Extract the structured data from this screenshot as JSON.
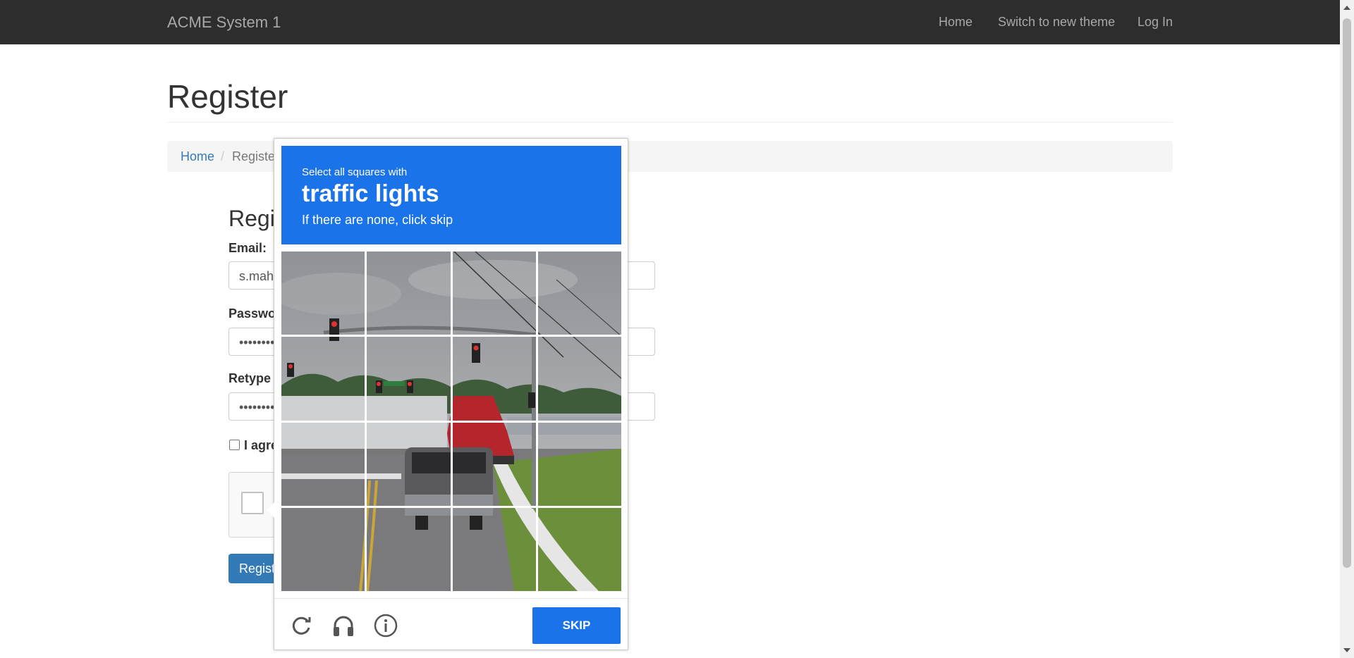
{
  "navbar": {
    "brand": "ACME System 1",
    "links": [
      "Home",
      "Switch to new theme",
      "Log In"
    ]
  },
  "page": {
    "title": "Register",
    "breadcrumb": {
      "home": "Home",
      "separator": "/",
      "current": "Registe"
    }
  },
  "form": {
    "heading": "Regi",
    "email_label": "Email:",
    "email_value": "s.mah",
    "password_label": "Passwo",
    "password_value": "•••••••••",
    "retype_label": "Retype",
    "retype_value": "•••••••••",
    "agree_label": "I agre",
    "register_label": "Regist"
  },
  "challenge": {
    "line1": "Select all squares with",
    "object": "traffic lights",
    "line3": "If there are none, click skip",
    "skip_label": "SKIP",
    "footer_icons": [
      "reload-icon",
      "headphones-icon",
      "info-icon"
    ],
    "header_color": "#1a73e8"
  }
}
